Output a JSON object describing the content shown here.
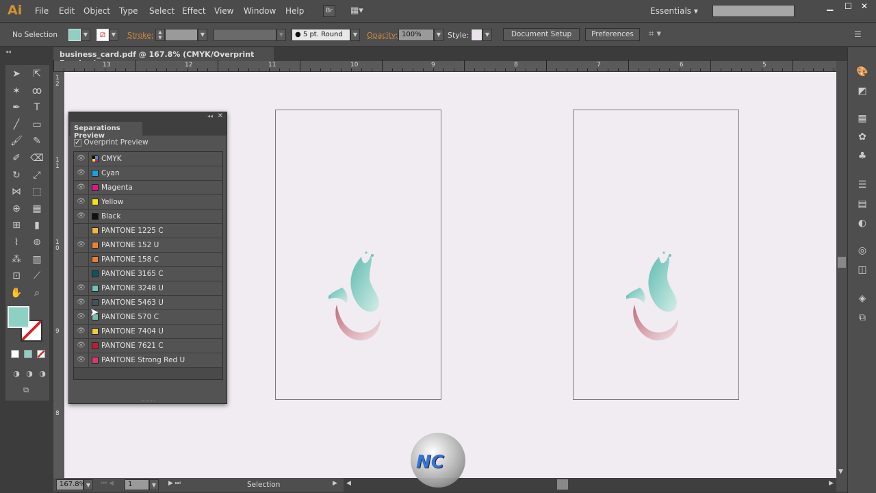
{
  "app": {
    "logo": "Ai",
    "menus": [
      "File",
      "Edit",
      "Object",
      "Type",
      "Select",
      "Effect",
      "View",
      "Window",
      "Help"
    ],
    "bridge": "Br",
    "workspace": "Essentials",
    "search_placeholder": ""
  },
  "control": {
    "selection": "No Selection",
    "stroke_label": "Stroke:",
    "brush": "5 pt. Round",
    "opacity_label": "Opacity:",
    "opacity": "100%",
    "style_label": "Style:",
    "doc_setup": "Document Setup",
    "preferences": "Preferences"
  },
  "document": {
    "tab": "business_card.pdf @ 167.8% (CMYK/Overprint Preview)",
    "close": "×"
  },
  "ruler": {
    "top": [
      "13",
      "12",
      "11",
      "10",
      "9",
      "8",
      "7",
      "6",
      "5"
    ],
    "left": [
      "1\n2",
      "1\n1",
      "1\n0",
      "9",
      "8"
    ]
  },
  "separations": {
    "title": "Separations Preview",
    "overprint_label": "Overprint Preview",
    "overprint_checked": true,
    "rows": [
      {
        "name": "CMYK",
        "color": "cmyk",
        "visible": true
      },
      {
        "name": "Cyan",
        "color": "#1ea0dc",
        "visible": true
      },
      {
        "name": "Magenta",
        "color": "#e0178a",
        "visible": true
      },
      {
        "name": "Yellow",
        "color": "#f2e21a",
        "visible": true
      },
      {
        "name": "Black",
        "color": "#111111",
        "visible": true
      },
      {
        "name": "PANTONE 1225 C",
        "color": "#f2b845",
        "visible": false
      },
      {
        "name": "PANTONE 152 U",
        "color": "#e5843c",
        "visible": true
      },
      {
        "name": "PANTONE 158 C",
        "color": "#e8803a",
        "visible": false
      },
      {
        "name": "PANTONE 3165 C",
        "color": "#11545f",
        "visible": false
      },
      {
        "name": "PANTONE 3248 U",
        "color": "#6cc5b8",
        "visible": true
      },
      {
        "name": "PANTONE 5463 U",
        "color": "#46525a",
        "visible": true
      },
      {
        "name": "PANTONE 570 C",
        "color": "#76bfae",
        "visible": true
      },
      {
        "name": "PANTONE 7404 U",
        "color": "#f2c84b",
        "visible": true
      },
      {
        "name": "PANTONE 7621 C",
        "color": "#b8222c",
        "visible": true
      },
      {
        "name": "PANTONE Strong Red U",
        "color": "#d93a6a",
        "visible": true
      }
    ]
  },
  "status": {
    "zoom": "167.8%",
    "artboard": "1",
    "tool": "Selection"
  },
  "colors": {
    "canvas": "#f1ebf2",
    "fill": "#8fd0c4",
    "accent": "#d5932f"
  }
}
